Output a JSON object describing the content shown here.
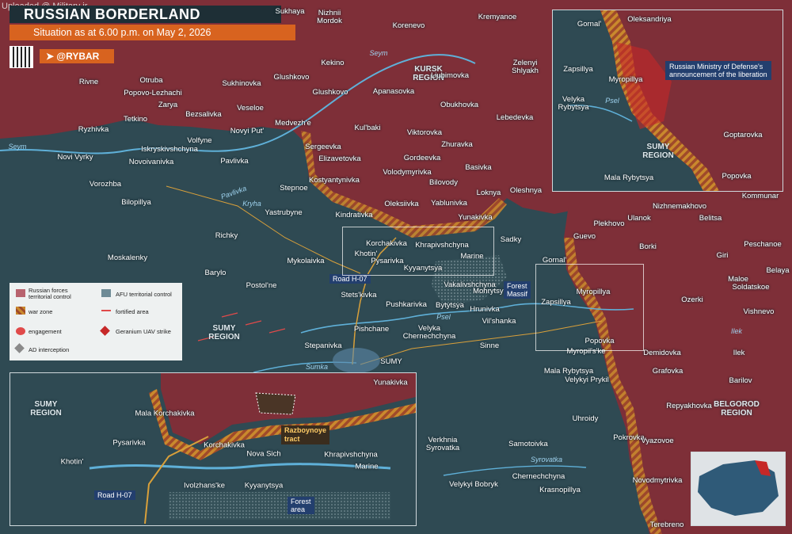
{
  "header": {
    "uploaded": "Uploaded @ Military ir",
    "title": "RUSSIAN BORDERLAND",
    "subtitle": "Situation as at 6.00 p.m. on May 2, 2026",
    "handle": "@RYBAR"
  },
  "legend": {
    "russian": "Russian forces territorial control",
    "afu": "AFU territorial control",
    "war_zone": "war zone",
    "fortified": "fortified area",
    "engagement": "engagement",
    "geranium": "Geranium UAV strike",
    "ad": "AD interception"
  },
  "regions": {
    "kursk": "KURSK\nREGION",
    "sumy": "SUMY\nREGION",
    "belgorod": "BELGOROD\nREGION"
  },
  "rivers": {
    "seym1": "Seym",
    "seym2": "Seym",
    "seym3": "Seym",
    "pavlivka": "Pavlivka",
    "krynka": "Kryha",
    "psel": "Psel",
    "sumka": "Sumka",
    "ilek": "Ilek",
    "syrovatka": "Syrovatka",
    "psel_inset": "Psel"
  },
  "places": [
    {
      "name": "Sukhaya"
    },
    {
      "name": "Nizhnii\nMordok"
    },
    {
      "name": "Korenevo"
    },
    {
      "name": "Kremyanoe"
    },
    {
      "name": "Kekino"
    },
    {
      "name": "Zelenyi\nShlyakh"
    },
    {
      "name": "Rivne"
    },
    {
      "name": "Otruba"
    },
    {
      "name": "Glushkovo"
    },
    {
      "name": "Liubimovka"
    },
    {
      "name": "Sukhinovka"
    },
    {
      "name": "Popovo-Lezhachi"
    },
    {
      "name": "Zarya"
    },
    {
      "name": "Veseloe"
    },
    {
      "name": "Glushkovo"
    },
    {
      "name": "Apanasovka"
    },
    {
      "name": "Obukhovka"
    },
    {
      "name": "Bezsalivka"
    },
    {
      "name": "Tetkino"
    },
    {
      "name": "Lebedevka"
    },
    {
      "name": "Medvezh'e"
    },
    {
      "name": "Kul'baki"
    },
    {
      "name": "Ryzhivka"
    },
    {
      "name": "Novyi Put'"
    },
    {
      "name": "Viktorovka"
    },
    {
      "name": "Volfyne"
    },
    {
      "name": "Sergeevka"
    },
    {
      "name": "Zhuravka"
    },
    {
      "name": "Iskryskivshchyna"
    },
    {
      "name": "Novi Vyrky"
    },
    {
      "name": "Elizavetovka"
    },
    {
      "name": "Gordeevka"
    },
    {
      "name": "Novoivanivka"
    },
    {
      "name": "Pavlivka"
    },
    {
      "name": "Volodymyrivka"
    },
    {
      "name": "Basivka"
    },
    {
      "name": "Vorozhba"
    },
    {
      "name": "Kostyantynivka"
    },
    {
      "name": "Bilovody"
    },
    {
      "name": "Stepnoe"
    },
    {
      "name": "Bilopillya"
    },
    {
      "name": "Loknya"
    },
    {
      "name": "Oleshnya"
    },
    {
      "name": "Kindrativka"
    },
    {
      "name": "Oleksiivka"
    },
    {
      "name": "Yablunivka"
    },
    {
      "name": "Yastrubyne"
    },
    {
      "name": "Yunakivka"
    },
    {
      "name": "Richky"
    },
    {
      "name": "Korchakivka"
    },
    {
      "name": "Sadky"
    },
    {
      "name": "Khrapivshchyna"
    },
    {
      "name": "Moskalenky"
    },
    {
      "name": "Mykolaivka"
    },
    {
      "name": "Khotin'"
    },
    {
      "name": "Pysarivka"
    },
    {
      "name": "Marine"
    },
    {
      "name": "Kyyanytsya"
    },
    {
      "name": "Barylo"
    },
    {
      "name": "Vakalivshchyna"
    },
    {
      "name": "Mohrytsya"
    },
    {
      "name": "Postol'ne"
    },
    {
      "name": "Stets'kivka"
    },
    {
      "name": "Pushkarivka"
    },
    {
      "name": "Bytytsya"
    },
    {
      "name": "Hrunivka"
    },
    {
      "name": "Pishchane"
    },
    {
      "name": "Velyka\nChernechchyna"
    },
    {
      "name": "Vil'shanka"
    },
    {
      "name": "Stepanivka"
    },
    {
      "name": "Sinne"
    },
    {
      "name": "SUMY"
    },
    {
      "name": "Gornal'"
    },
    {
      "name": "Myropillya"
    },
    {
      "name": "Zapsillya"
    },
    {
      "name": "Popovka"
    },
    {
      "name": "Myropil's'ke"
    },
    {
      "name": "Demidovka"
    },
    {
      "name": "Mala Rybytsya"
    },
    {
      "name": "Velykyi Prykil"
    },
    {
      "name": "Grafovka"
    },
    {
      "name": "Kommunar"
    },
    {
      "name": "Nizhnemakhovo"
    },
    {
      "name": "Ulanok"
    },
    {
      "name": "Belitsa"
    },
    {
      "name": "Plekhovo"
    },
    {
      "name": "Guevo"
    },
    {
      "name": "Borki"
    },
    {
      "name": "Peschanoe"
    },
    {
      "name": "Giri"
    },
    {
      "name": "Maloe"
    },
    {
      "name": "Soldatskoe"
    },
    {
      "name": "Ozerki"
    },
    {
      "name": "Vishnevo"
    },
    {
      "name": "Ilek"
    },
    {
      "name": "Barilov"
    },
    {
      "name": "Repyakhovka"
    },
    {
      "name": "Uhroidy"
    },
    {
      "name": "Pokrovka"
    },
    {
      "name": "Vyazovoe"
    },
    {
      "name": "Verkhnia\nSyrovatka"
    },
    {
      "name": "Samotoivka"
    },
    {
      "name": "Chernechchyna"
    },
    {
      "name": "Novodmytrivka"
    },
    {
      "name": "Velykyi Bobryk"
    },
    {
      "name": "Krasnopillya"
    },
    {
      "name": "Terebreno"
    },
    {
      "name": "Belaya"
    }
  ],
  "road_h07": "Road H-07",
  "forest_massif": "Forest\nMassif",
  "inset_ne": {
    "places": [
      "Gornal'",
      "Oleksandriya",
      "Zapsillya",
      "Myropillya",
      "Velyka\nRybytsya",
      "Goptarovka",
      "Popovka",
      "Mala Rybytsya"
    ],
    "region": "SUMY\nREGION",
    "mod_note": "Russian Ministry of Defense's\nannouncement of the liberation"
  },
  "inset_sw": {
    "places": [
      "Yunakivka",
      "Mala Korchakivka",
      "Korchakivka",
      "Pysarivka",
      "Khotin'",
      "Nova Sich",
      "Khrapivshchyna",
      "Ivolzhans'ke",
      "Kyyanytsya",
      "Marine"
    ],
    "region": "SUMY\nREGION",
    "tract": "Razboynoye\ntract",
    "road": "Road H-07",
    "forest": "Forest\narea"
  }
}
